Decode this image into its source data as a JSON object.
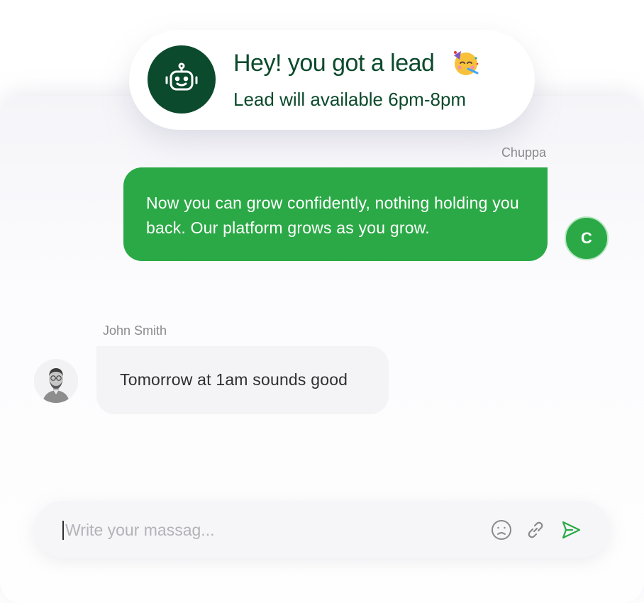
{
  "notification": {
    "title": "Hey! you got a lead",
    "subtitle": "Lead will available 6pm-8pm",
    "icon": "robot-icon",
    "emoji_icon": "partying-face-emoji-icon"
  },
  "messages": [
    {
      "sender": "Chuppa",
      "avatar_initial": "C",
      "text": "Now you can grow confidently, nothing holding you back. Our platform grows as you grow."
    },
    {
      "sender": "John Smith",
      "avatar": "user-photo-avatar",
      "text": "Tomorrow at 1am sounds good"
    }
  ],
  "composer": {
    "placeholder": "Write your massag...",
    "value": "",
    "emoji_icon": "smiley-icon",
    "attach_icon": "link-icon",
    "send_icon": "send-icon"
  },
  "colors": {
    "brand_dark": "#0b4a2c",
    "bubble_green": "#2ba946",
    "bubble_gray": "#f4f4f7",
    "muted_text": "#8a8a8e",
    "placeholder": "#b2b2b8"
  }
}
